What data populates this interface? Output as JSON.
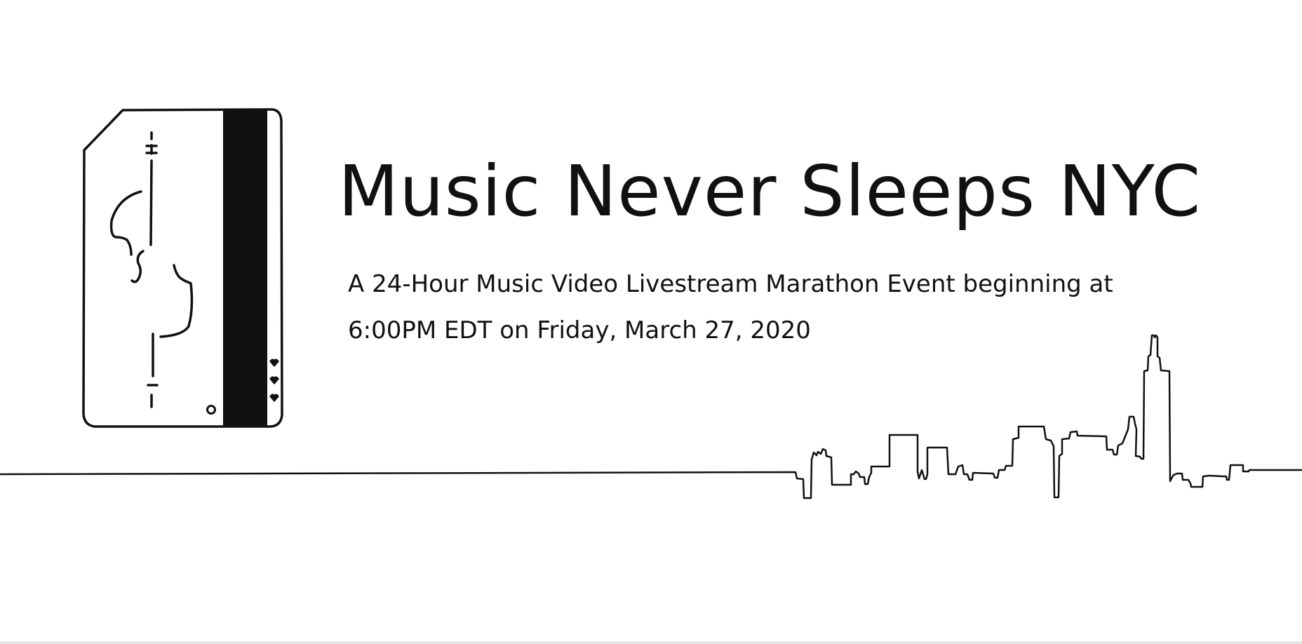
{
  "title": "Music Never Sleeps NYC",
  "subtitle": {
    "line1": "A 24-Hour Music Video Livestream Marathon Event beginning at",
    "line2": "6:00PM EDT on Friday, March 27, 2020"
  },
  "logo": {
    "icon": "metrocard-violin-icon"
  },
  "skyline": {
    "icon": "nyc-skyline-icon"
  },
  "colors": {
    "background": "#ffffff",
    "ink": "#111111"
  }
}
